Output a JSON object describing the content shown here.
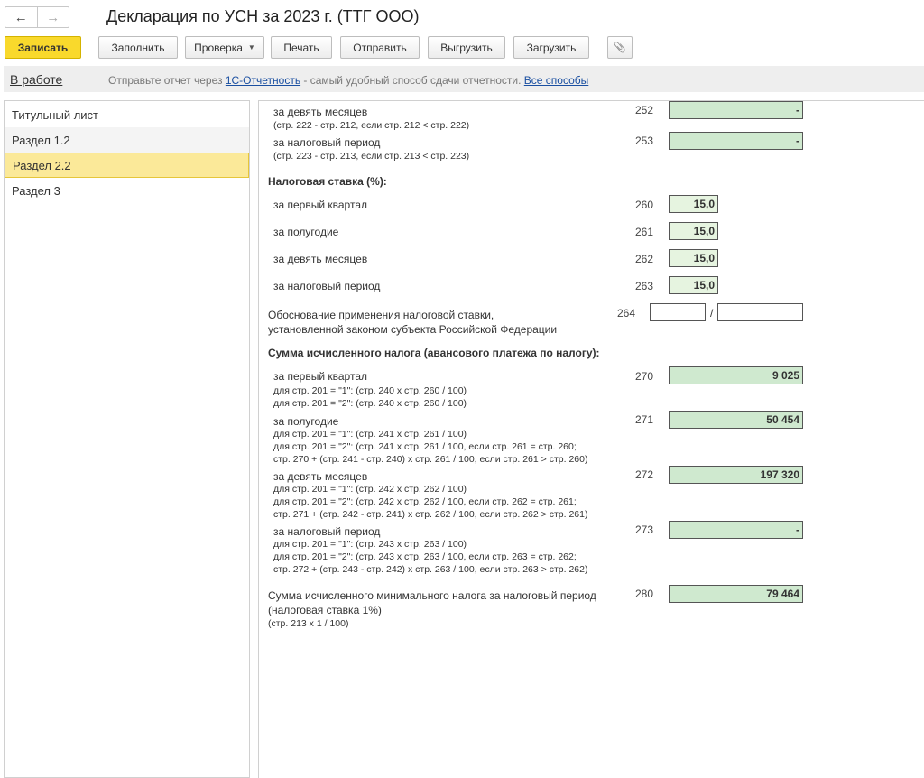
{
  "window": {
    "title": "Декларация по УСН за 2023 г. (ТТГ ООО)",
    "back_icon": "←",
    "forward_icon": "→"
  },
  "toolbar": {
    "save": "Записать",
    "fill": "Заполнить",
    "check": "Проверка",
    "print": "Печать",
    "send": "Отправить",
    "export": "Выгрузить",
    "import": "Загрузить",
    "caret_icon": "▼",
    "attach_icon": "📎"
  },
  "infobar": {
    "status": "В работе",
    "hint_prefix": "Отправьте отчет через ",
    "hint_link": "1С-Отчетность",
    "hint_middle": " - самый удобный способ сдачи отчетности. ",
    "hint_link2": "Все способы"
  },
  "sidebar": {
    "items": [
      {
        "label": "Титульный лист"
      },
      {
        "label": "Раздел 1.2"
      },
      {
        "label": "Раздел 2.2"
      },
      {
        "label": "Раздел 3"
      }
    ],
    "selected": "Раздел 2.2"
  },
  "form": {
    "r252": {
      "label": "за девять месяцев",
      "sub": "(стр. 222 - стр. 212, если стр. 212 < стр. 222)",
      "code": "252",
      "value": "-"
    },
    "r253": {
      "label": "за налоговый период",
      "sub": "(стр. 223 - стр. 213, если стр. 213 < стр. 223)",
      "code": "253",
      "value": "-"
    },
    "rate_header": "Налоговая ставка (%):",
    "r260": {
      "label": "за первый квартал",
      "code": "260",
      "value": "15,0"
    },
    "r261": {
      "label": "за полугодие",
      "code": "261",
      "value": "15,0"
    },
    "r262": {
      "label": "за девять месяцев",
      "code": "262",
      "value": "15,0"
    },
    "r263": {
      "label": "за налоговый период",
      "code": "263",
      "value": "15,0"
    },
    "r264": {
      "line1": "Обоснование применения налоговой ставки,",
      "line2": "установленной законом субъекта Российской Федерации",
      "code": "264",
      "value1": "",
      "value2": "",
      "slash": "/"
    },
    "tax_header": "Сумма исчисленного налога (авансового платежа по налогу):",
    "r270": {
      "label": "за первый квартал",
      "sub1": "для стр. 201 = \"1\": (стр. 240 х стр. 260 / 100)",
      "sub2": "для стр. 201 = \"2\": (стр. 240 х стр. 260 / 100)",
      "code": "270",
      "value": "9 025"
    },
    "r271": {
      "label": "за полугодие",
      "sub1": "для стр. 201 = \"1\": (стр. 241 х стр. 261 / 100)",
      "sub2": "для стр. 201 = \"2\": (стр. 241 х стр. 261 / 100, если стр. 261 = стр. 260;",
      "sub3": "стр. 270 + (стр. 241 - стр. 240) х стр. 261 / 100, если стр. 261 > стр. 260)",
      "code": "271",
      "value": "50 454"
    },
    "r272": {
      "label": "за девять месяцев",
      "sub1": "для стр. 201 = \"1\": (стр. 242 х стр. 262 / 100)",
      "sub2": "для стр. 201 = \"2\": (стр. 242 х стр. 262 / 100, если стр. 262 = стр. 261;",
      "sub3": "стр. 271 + (стр. 242 - стр. 241) х стр. 262 / 100, если стр. 262 > стр. 261)",
      "code": "272",
      "value": "197 320"
    },
    "r273": {
      "label": "за налоговый период",
      "sub1": "для стр. 201 = \"1\": (стр. 243 х стр. 263 / 100)",
      "sub2": "для стр. 201 = \"2\": (стр. 243 х стр. 263 / 100, если стр. 263 = стр. 262;",
      "sub3": "стр. 272 + (стр. 243 - стр. 242) х стр. 263 / 100, если стр. 263 > стр. 262)",
      "code": "273",
      "value": "-"
    },
    "r280": {
      "line1": "Сумма исчисленного минимального налога за налоговый период",
      "line2": "(налоговая ставка 1%)",
      "sub": "(стр. 213 х 1 / 100)",
      "code": "280",
      "value": "79 464"
    }
  },
  "colors": {
    "primary_button": "#f9d92c",
    "field_green": "#cfe9cf",
    "selected_nav": "#fbe999",
    "link": "#1a4fa1"
  }
}
